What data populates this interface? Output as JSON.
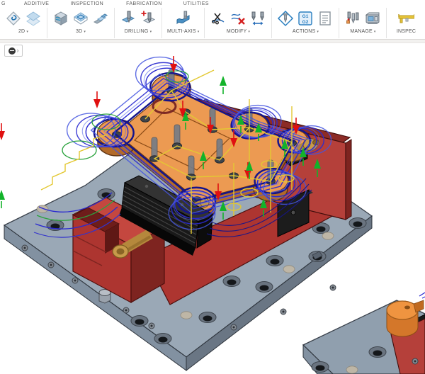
{
  "toolbar": {
    "caret": "▾",
    "tabs": [
      {
        "label": "G"
      },
      {
        "label": "ADDITIVE"
      },
      {
        "label": "INSPECTION"
      },
      {
        "label": "FABRICATION"
      },
      {
        "label": "UTILITIES"
      }
    ],
    "groups": [
      {
        "label": "2D"
      },
      {
        "label": "3D"
      },
      {
        "label": "DRILLING"
      },
      {
        "label": "MULTI-AXIS"
      },
      {
        "label": "MODIFY"
      },
      {
        "label": "ACTIONS"
      },
      {
        "label": "MANAGE"
      },
      {
        "label": "INSPEC"
      }
    ],
    "post_icon_lines": [
      "G1",
      "G2"
    ]
  },
  "browser_toggle": {
    "chevron": "›"
  },
  "scene": {
    "viewport_background": "#ffffff",
    "colors": {
      "plate_top": "#9aa8b6",
      "plate_left": "#8291a1",
      "plate_right": "#6a7684",
      "plate2_top": "#909fae",
      "outline": "#39404a",
      "vise_red": "#ad3530",
      "vise_red_light": "#c4473f",
      "vise_red_dark": "#7e2420",
      "rail_red": "#b5403a",
      "rail_top": "#8c2b26",
      "jaw_black": "#191919",
      "jaw_top": "#333333",
      "brass": "#b5883c",
      "brass_light": "#c79a4a",
      "brass_dark": "#8a6526",
      "part_top": "#ec9a52",
      "part_side": "#b26a29",
      "part_outline": "#6b3a12",
      "cam_orange": "#ef9440",
      "toolpath_blue": "#2a2ad0",
      "toolpath_navy": "#14148c",
      "toolpath_yellow": "#e3c832",
      "toolpath_green": "#2ba33e",
      "arrow_red": "#e01010",
      "arrow_green": "#12b32a"
    }
  }
}
